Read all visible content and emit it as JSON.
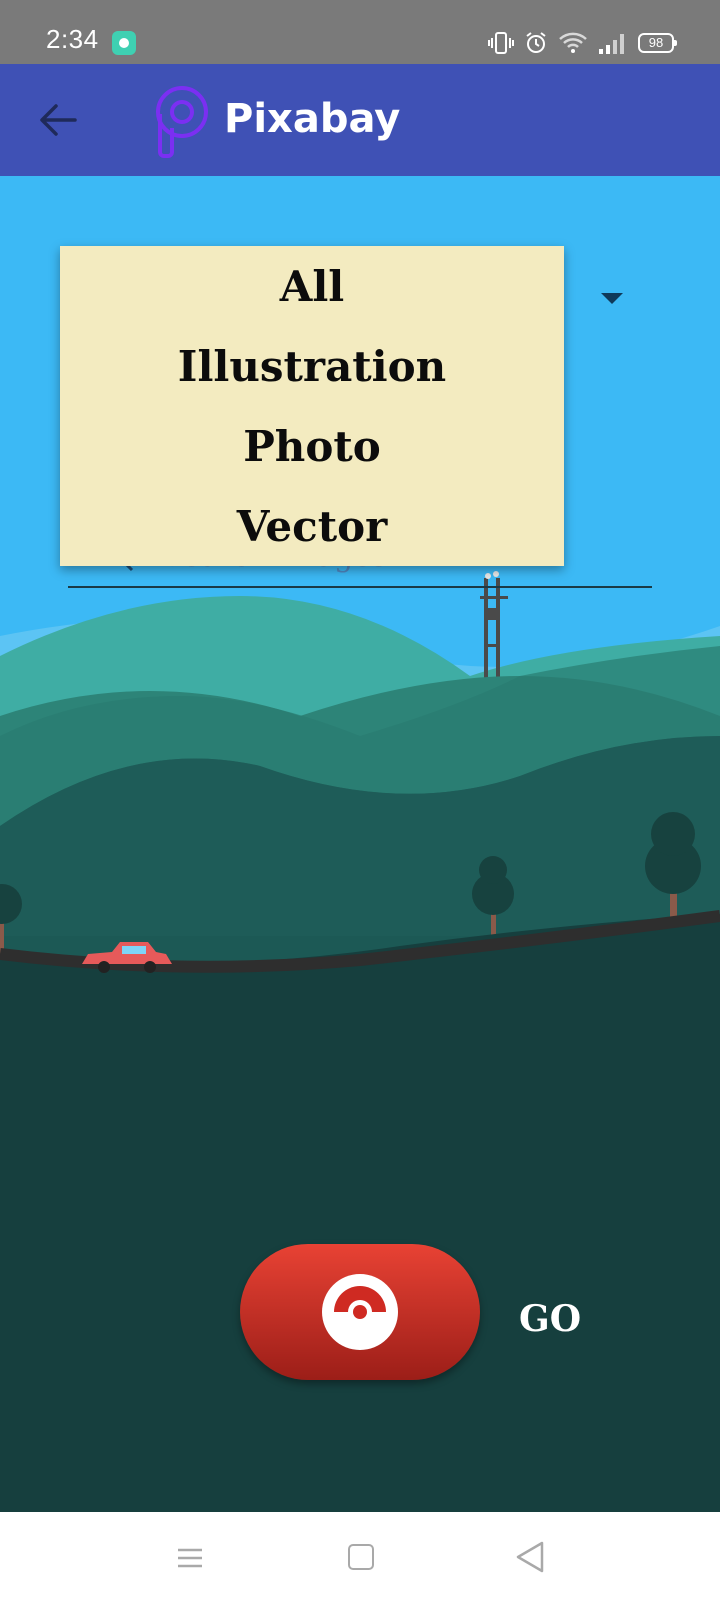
{
  "status_bar": {
    "time": "2:34",
    "battery": "98",
    "icons": [
      "app-notification-icon",
      "vibrate-icon",
      "alarm-icon",
      "wifi-icon",
      "signal-icon",
      "battery-icon"
    ]
  },
  "app_bar": {
    "title": "Pixabay",
    "back_icon": "arrow-left-icon",
    "logo": "pixabay-logo"
  },
  "search": {
    "placeholder": "Search images",
    "value": ""
  },
  "type_spinner": {
    "options": [
      "All",
      "Illustration",
      "Photo",
      "Vector"
    ]
  },
  "go_button": {
    "icon": "pokeball-icon",
    "label": "GO"
  },
  "nav_bar": {
    "icons": [
      "menu-icon",
      "home-icon",
      "back-icon"
    ]
  },
  "colors": {
    "app_bar": "#3f51b5",
    "sky": "#3cb9f5",
    "dropdown_bg": "#f3ebc0",
    "go_button": "#e84234",
    "ground": "#163f3e"
  }
}
